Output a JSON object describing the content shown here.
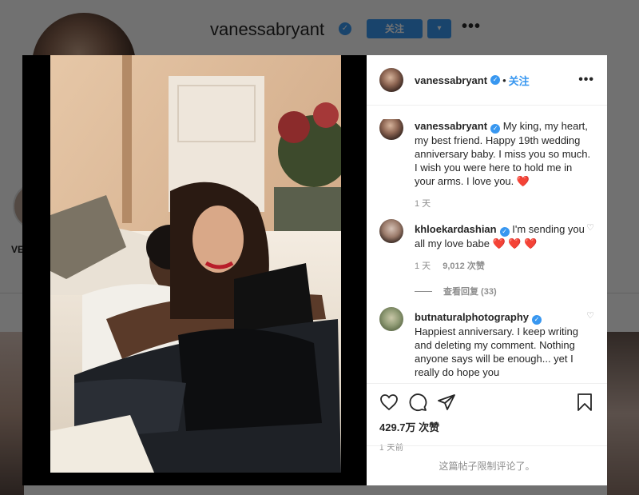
{
  "profile": {
    "username": "vanessabryant",
    "follow_label": "关注",
    "more_label": "•••",
    "highlight_label": "VE",
    "dropdown_label": "▾"
  },
  "post": {
    "author": "vanessabryant",
    "follow_label": "关注",
    "dot": "•",
    "more_label": "•••",
    "caption": {
      "username": "vanessabryant",
      "text": "My king, my heart, my best friend. Happy 19th wedding anniversary baby. I miss you so much. I wish you were here to hold me in your arms. I love you. ❤️",
      "age": "1 天"
    },
    "comments": [
      {
        "username": "khloekardashian",
        "text": "I'm sending you all my love babe ❤️ ❤️ ❤️",
        "age": "1 天",
        "likes": "9,012 次赞",
        "view_replies": "查看回复 (33)"
      },
      {
        "username": "butnaturalphotography",
        "text": "Happiest anniversary. I keep writing and deleting my comment. Nothing anyone says will be enough... yet I really do hope you"
      }
    ],
    "likes": "429.7万 次赞",
    "timestamp": "1 天前",
    "comments_limited": "这篇帖子限制评论了。"
  },
  "icons": {
    "verified": "verified-badge-icon",
    "like": "heart-icon",
    "comment": "comment-icon",
    "share": "share-icon",
    "save": "bookmark-icon",
    "comment_like": "small-heart-icon"
  },
  "colors": {
    "accent": "#3897f0",
    "heart": "#ed4956",
    "muted": "#8e8e8e"
  }
}
